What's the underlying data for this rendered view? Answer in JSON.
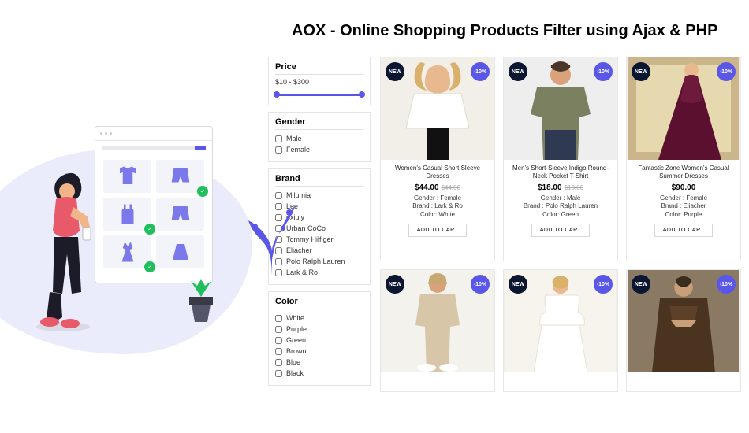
{
  "title": "AOX - Online Shopping Products Filter using Ajax & PHP",
  "filters": {
    "price": {
      "heading": "Price",
      "range_text": "$10 - $300"
    },
    "gender": {
      "heading": "Gender",
      "options": [
        "Male",
        "Female"
      ]
    },
    "brand": {
      "heading": "Brand",
      "options": [
        "Milumia",
        "Lee",
        "oxiuly",
        "Urban CoCo",
        "Tommy Hilfiger",
        "Eliacher",
        "Polo Ralph Lauren",
        "Lark & Ro"
      ]
    },
    "color": {
      "heading": "Color",
      "options": [
        "White",
        "Purple",
        "Green",
        "Brown",
        "Blue",
        "Black"
      ]
    }
  },
  "badges": {
    "new": "NEW",
    "discount": "-10%"
  },
  "products": [
    {
      "name": "Women's Casual Short Sleeve Dresses",
      "price": "$44.00",
      "old_price": "$44.00",
      "gender": "Gender : Female",
      "brand": "Brand : Lark & Ro",
      "color": "Color: White",
      "btn": "ADD TO CART",
      "img_bg": "#f2efe9",
      "figure": "woman-white-shirt"
    },
    {
      "name": "Men's Short-Sleeve Indigo Round-Neck Pocket T-Shirt",
      "price": "$18.00",
      "old_price": "$18.00",
      "gender": "Gender : Male",
      "brand": "Brand : Polo Ralph Lauren",
      "color": "Color: Green",
      "btn": "ADD TO CART",
      "img_bg": "#eeeeee",
      "figure": "man-olive-tee"
    },
    {
      "name": "Fantastic Zone Women's Casual Summer Dresses",
      "price": "$90.00",
      "old_price": "",
      "gender": "Gender : Female",
      "brand": "Brand : Eliacher",
      "color": "Color: Purple",
      "btn": "ADD TO CART",
      "img_bg": "#cbb68b",
      "figure": "woman-purple-gown"
    }
  ],
  "products_row2": [
    {
      "img_bg": "#f4f2ed",
      "figure": "man-beige-tracksuit"
    },
    {
      "img_bg": "#f7f4ee",
      "figure": "woman-white-dress"
    },
    {
      "img_bg": "#8a7a63",
      "figure": "man-brown-coat"
    }
  ]
}
